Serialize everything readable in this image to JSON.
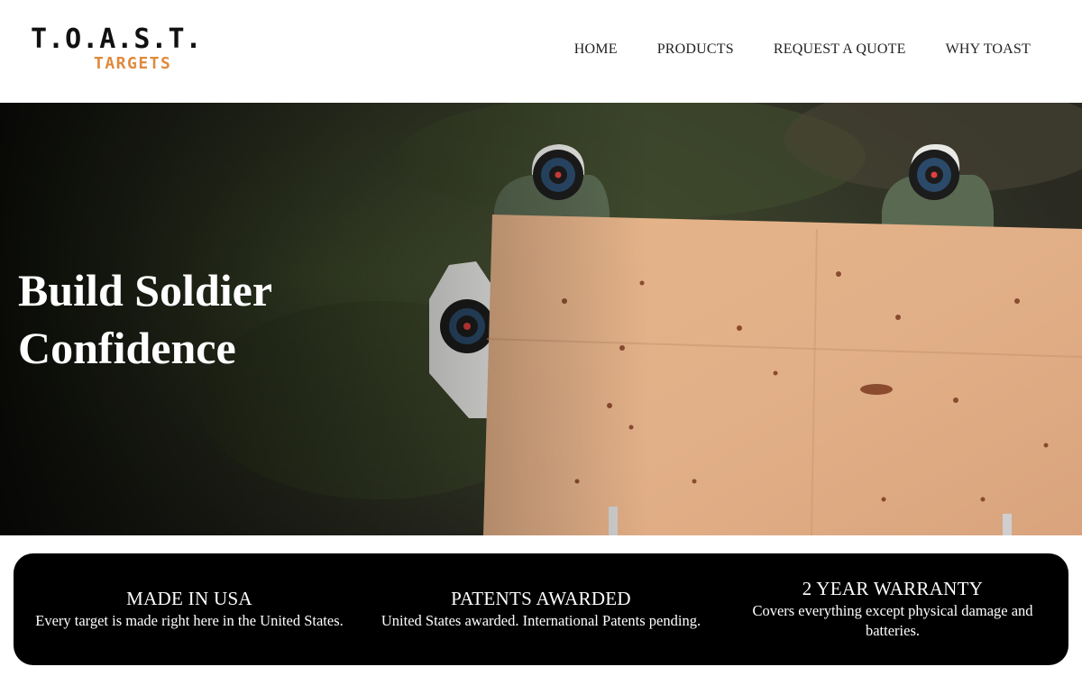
{
  "logo": {
    "line1": "T.O.A.S.T.",
    "line2": "TARGETS"
  },
  "nav": {
    "items": [
      {
        "label": "HOME"
      },
      {
        "label": "PRODUCTS"
      },
      {
        "label": "REQUEST A QUOTE"
      },
      {
        "label": "WHY TOAST"
      }
    ]
  },
  "hero": {
    "title": "Build Soldier Confidence"
  },
  "features": [
    {
      "title": "MADE IN USA",
      "description": "Every target is made right here in the United States."
    },
    {
      "title": "PATENTS AWARDED",
      "description": "United States awarded. International Patents pending."
    },
    {
      "title": "2 YEAR WARRANTY",
      "description": "Covers everything except physical damage and batteries."
    }
  ],
  "colors": {
    "accent": "#e08a3c",
    "feature_bar": "#000000",
    "hero_text": "#ffffff"
  }
}
